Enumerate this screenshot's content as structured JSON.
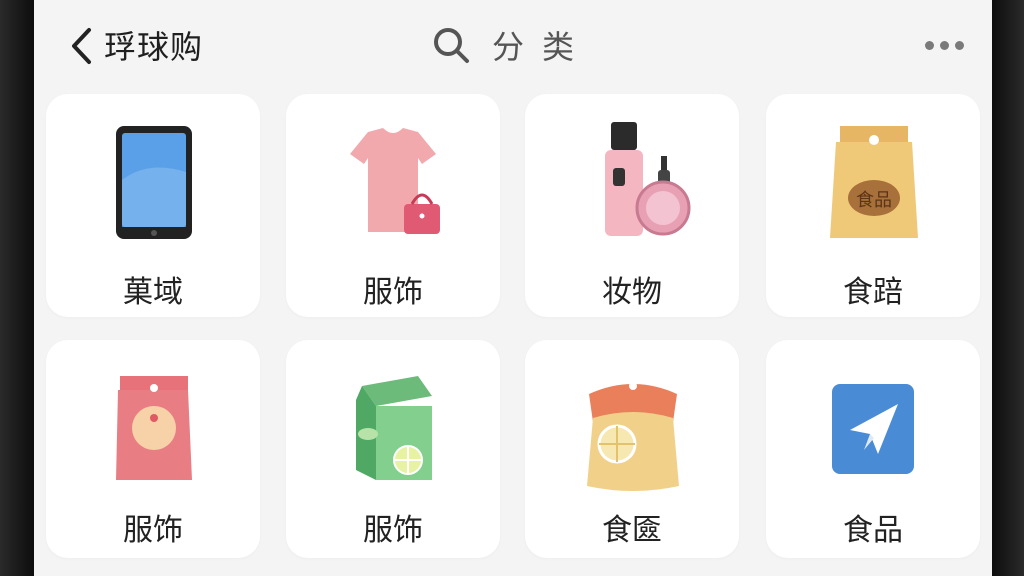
{
  "header": {
    "app_title": "琈球购",
    "page_title": "分类",
    "icons": {
      "back": "chevron-left-icon",
      "search": "search-icon",
      "more": "more-dots-icon"
    }
  },
  "categories": [
    {
      "label": "菓域",
      "icon": "tablet-phone-icon"
    },
    {
      "label": "服饰",
      "icon": "tshirt-handbag-icon"
    },
    {
      "label": "妆物",
      "icon": "cosmetics-icon"
    },
    {
      "label": "食踣",
      "icon": "food-bag-icon"
    },
    {
      "label": "服饰",
      "icon": "red-food-bag-icon"
    },
    {
      "label": "服饰",
      "icon": "green-milk-carton-icon"
    },
    {
      "label": "食匳",
      "icon": "snack-bag-icon"
    },
    {
      "label": "食品",
      "icon": "paper-plane-app-icon"
    }
  ],
  "colors": {
    "background": "#f4f4f4",
    "card": "#ffffff",
    "text": "#222222",
    "secondary_text": "#555555"
  }
}
